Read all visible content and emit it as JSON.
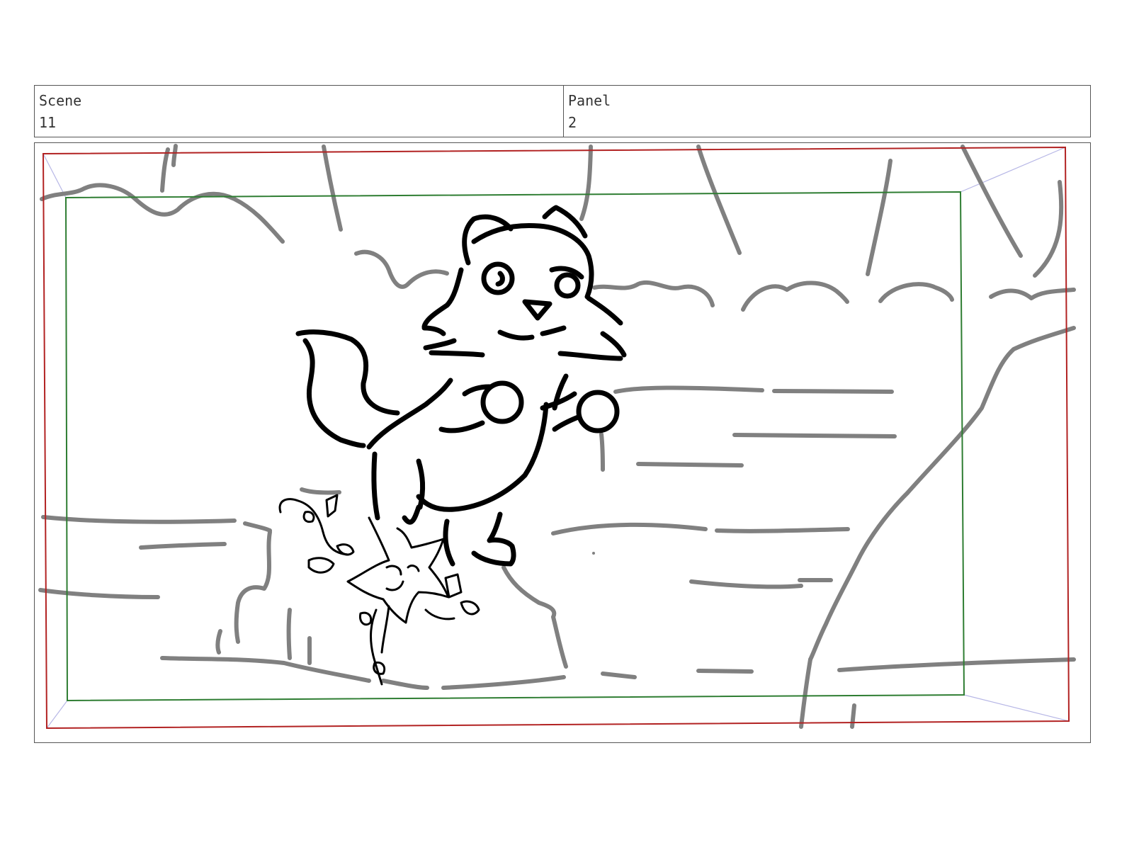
{
  "header": {
    "scene_label": "Scene",
    "scene_value": "11",
    "panel_label": "Panel",
    "panel_value": "2"
  },
  "colors": {
    "action_safe": "#b22222",
    "title_safe": "#2e7d32",
    "perspective_guides": "#b7b7e6",
    "background_lines": "#808080",
    "character_lines": "#000000"
  }
}
